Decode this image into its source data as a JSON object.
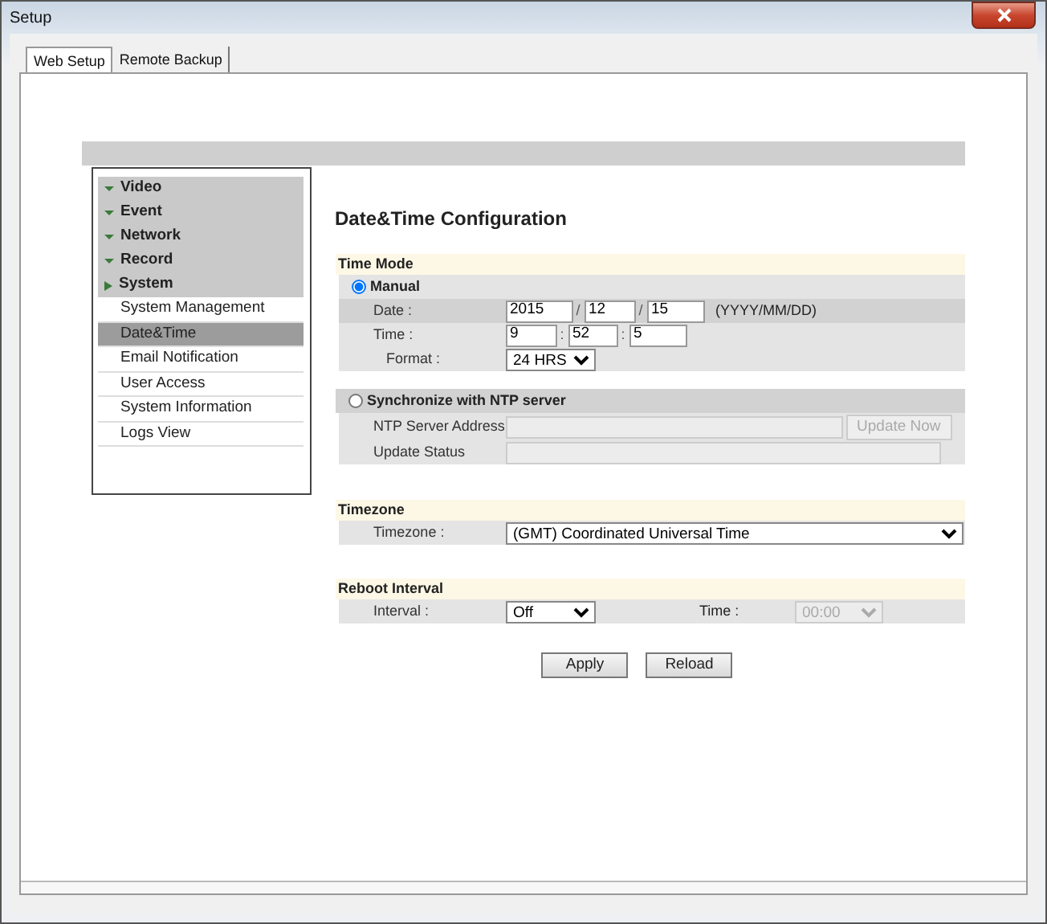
{
  "window": {
    "title": "Setup"
  },
  "tabs": [
    {
      "label": "Web Setup",
      "selected": true
    },
    {
      "label": "Remote Backup",
      "selected": false
    }
  ],
  "sidebar": {
    "groups": [
      {
        "label": "Video",
        "expanded": false
      },
      {
        "label": "Event",
        "expanded": false
      },
      {
        "label": "Network",
        "expanded": false
      },
      {
        "label": "Record",
        "expanded": false
      },
      {
        "label": "System",
        "expanded": true,
        "children": [
          {
            "label": "System Management",
            "selected": false
          },
          {
            "label": "Date&Time",
            "selected": true
          },
          {
            "label": "Email Notification",
            "selected": false
          },
          {
            "label": "User Access",
            "selected": false
          },
          {
            "label": "System Information",
            "selected": false
          },
          {
            "label": "Logs View",
            "selected": false
          }
        ]
      }
    ]
  },
  "page_title": "Date&Time Configuration",
  "time_mode": {
    "heading": "Time Mode",
    "manual": {
      "label": "Manual",
      "selected": true
    },
    "date": {
      "label": "Date :",
      "year": "2015",
      "sep1": "/",
      "month": "12",
      "sep2": "/",
      "day": "15",
      "hint": "(YYYY/MM/DD)"
    },
    "time": {
      "label": "Time :",
      "hour": "9",
      "sep1": ":",
      "minute": "52",
      "sep2": ":",
      "second": "5"
    },
    "format": {
      "label": "Format :",
      "value": "24 HRS"
    },
    "ntp": {
      "label": "Synchronize with NTP server",
      "selected": false
    },
    "ntp_server": {
      "label": "NTP Server Address",
      "disabled": true
    },
    "update_button": {
      "label": "Update Now",
      "disabled": true
    },
    "update_status": {
      "label": "Update Status",
      "disabled": true
    }
  },
  "timezone": {
    "heading": "Timezone",
    "label": "Timezone :",
    "value": "(GMT) Coordinated Universal Time"
  },
  "reboot": {
    "heading": "Reboot Interval",
    "interval_label": "Interval :",
    "interval": "Off",
    "time_label": "Time :",
    "time": {
      "value": "00:00",
      "disabled": true
    }
  },
  "buttons": [
    "Apply",
    "Reload"
  ]
}
